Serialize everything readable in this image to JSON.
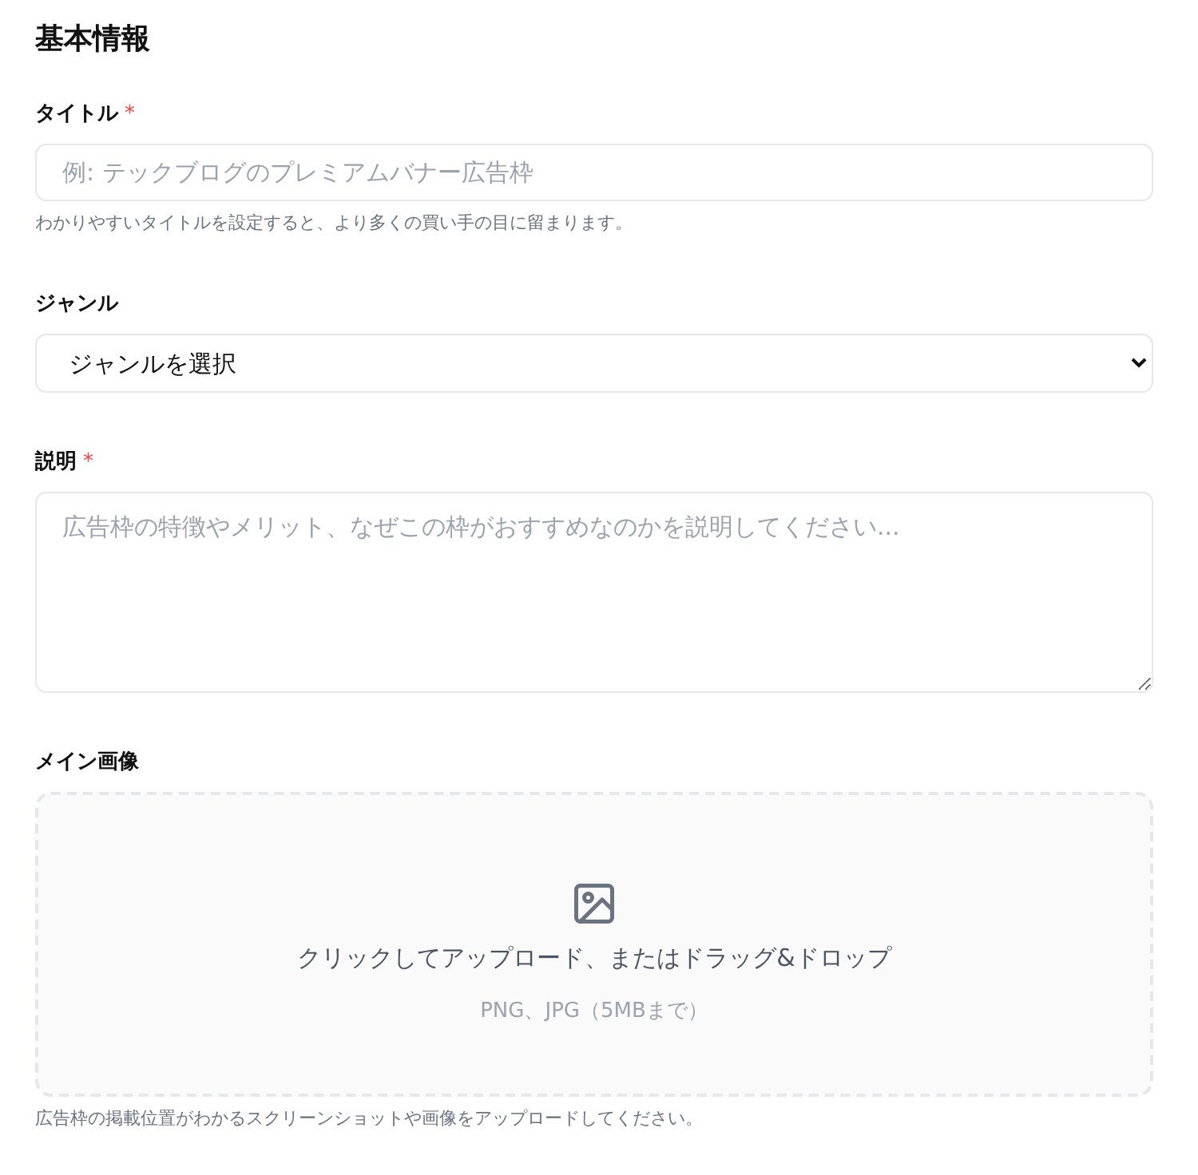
{
  "section_title": "基本情報",
  "fields": [
    {
      "kind": "text",
      "label": "タイトル",
      "required_mark": "*",
      "placeholder": "例: テックブログのプレミアムバナー広告枠",
      "hint": "わかりやすいタイトルを設定すると、より多くの買い手の目に留まります。"
    },
    {
      "kind": "select",
      "label": "ジャンル",
      "value": "ジャンルを選択"
    },
    {
      "kind": "textarea",
      "label": "説明",
      "required_mark": "*",
      "placeholder": "広告枠の特徴やメリット、なぜこの枠がおすすめなのかを説明してください..."
    },
    {
      "kind": "upload",
      "label": "メイン画像",
      "prompt": "クリックしてアップロード、またはドラッグ&ドロップ",
      "formats": "PNG、JPG（5MBまで）",
      "hint": "広告枠の掲載位置がわかるスクリーンショットや画像をアップロードしてください。"
    }
  ]
}
